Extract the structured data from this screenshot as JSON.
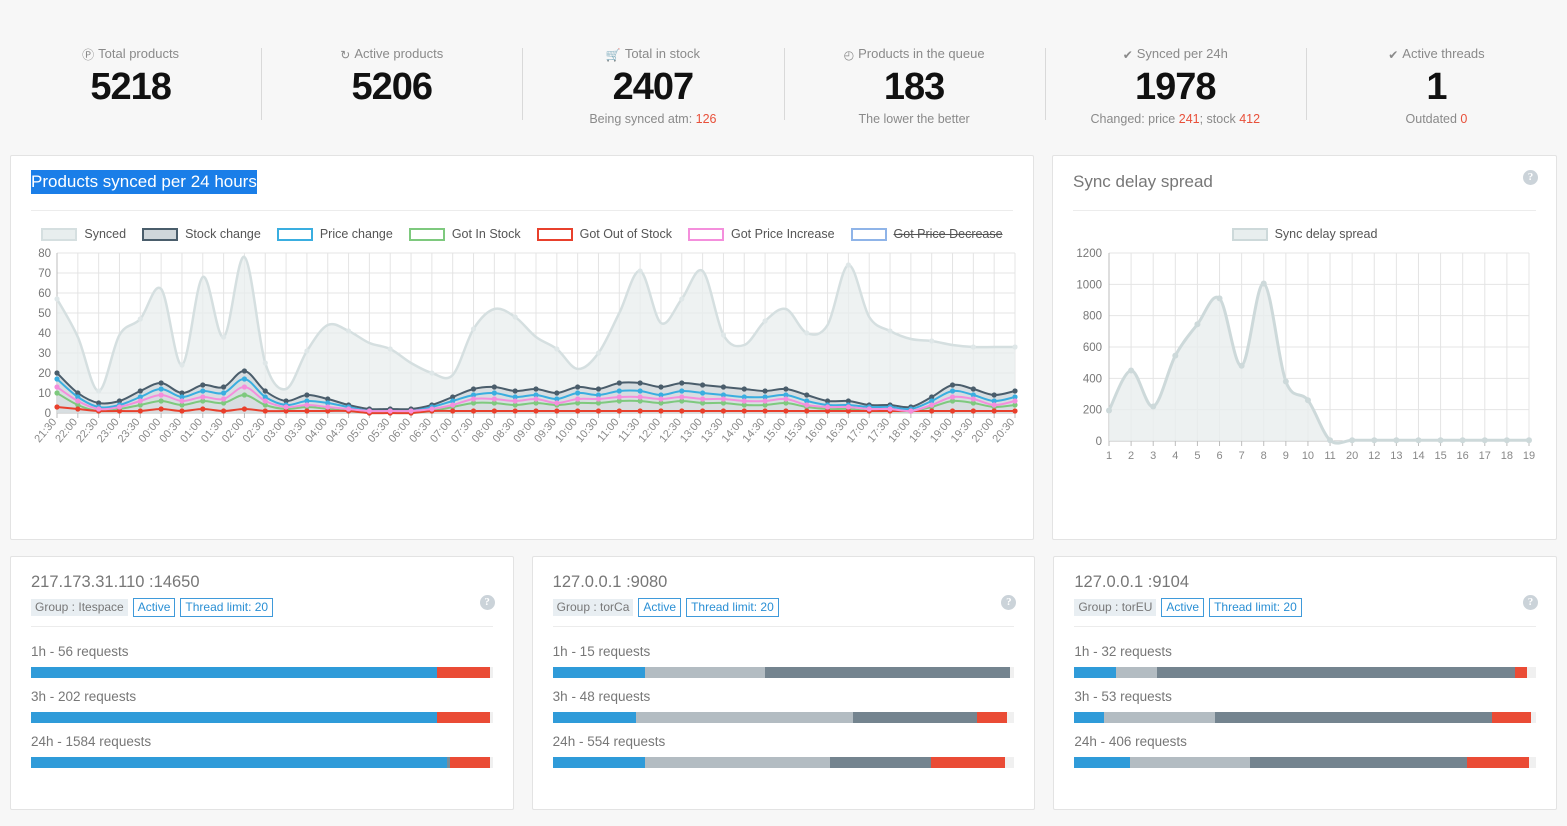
{
  "stats": [
    {
      "icon": "product-icon",
      "icon_glyph": "Ⓟ",
      "label": "Total products",
      "value": "5218",
      "sub": "",
      "sub_accent": ""
    },
    {
      "icon": "refresh-icon",
      "icon_glyph": "↻",
      "label": "Active products",
      "value": "5206",
      "sub": "",
      "sub_accent": ""
    },
    {
      "icon": "cart-icon",
      "icon_glyph": "🛒",
      "label": "Total in stock",
      "value": "2407",
      "sub": "Being synced atm: ",
      "sub_accent": "126"
    },
    {
      "icon": "clock-icon",
      "icon_glyph": "◴",
      "label": "Products in the queue",
      "value": "183",
      "sub": "The lower the better",
      "sub_accent": ""
    },
    {
      "icon": "check-icon",
      "icon_glyph": "✔",
      "label": "Synced per 24h",
      "value": "1978",
      "sub": "Changed: price ",
      "sub_accent": "241",
      "sub2": "; stock ",
      "sub_accent2": "412"
    },
    {
      "icon": "check-icon",
      "icon_glyph": "✔",
      "label": "Active threads",
      "value": "1",
      "sub": "Outdated ",
      "sub_accent": "0"
    }
  ],
  "main_chart_panel": {
    "title": "Products synced per 24 hours",
    "title_selected": true,
    "help_icon": "help-icon"
  },
  "side_chart_panel": {
    "title": "Sync delay spread",
    "help_icon": "help-icon"
  },
  "chart_data": [
    {
      "type": "area",
      "title": "Products synced per 24 hours",
      "xlabel": "",
      "ylabel": "",
      "ylim": [
        0,
        80
      ],
      "yticks": [
        0,
        10,
        20,
        30,
        40,
        50,
        60,
        70,
        80
      ],
      "grid": true,
      "legend_position": "top",
      "categories": [
        "21:30",
        "22:00",
        "22:30",
        "23:00",
        "23:30",
        "00:00",
        "00:30",
        "01:00",
        "01:30",
        "02:00",
        "02:30",
        "03:00",
        "03:30",
        "04:00",
        "04:30",
        "05:00",
        "05:30",
        "06:00",
        "06:30",
        "07:00",
        "07:30",
        "08:00",
        "08:30",
        "09:00",
        "09:30",
        "10:00",
        "10:30",
        "11:00",
        "11:30",
        "12:00",
        "12:30",
        "13:00",
        "13:30",
        "14:00",
        "14:30",
        "15:00",
        "15:30",
        "16:00",
        "16:30",
        "17:00",
        "17:30",
        "18:00",
        "18:30",
        "19:00",
        "19:30",
        "20:00",
        "20:30"
      ],
      "series": [
        {
          "name": "Synced",
          "color": "#e8eeee",
          "line_color": "#d5dfe0",
          "fill": true,
          "values": [
            57,
            38,
            11,
            39,
            47,
            62,
            24,
            68,
            38,
            78,
            25,
            12,
            31,
            44,
            41,
            35,
            32,
            25,
            20,
            19,
            42,
            52,
            48,
            38,
            32,
            22,
            30,
            50,
            71,
            45,
            57,
            71,
            39,
            34,
            46,
            52,
            40,
            44,
            74,
            48,
            41,
            37,
            36,
            34,
            33,
            33,
            33
          ]
        },
        {
          "name": "Stock change",
          "color": "#cfd6da",
          "line_color": "#4a5d6b",
          "fill": true,
          "values": [
            20,
            10,
            5,
            6,
            11,
            15,
            10,
            14,
            13,
            21,
            11,
            6,
            9,
            7,
            4,
            2,
            2,
            2,
            4,
            8,
            12,
            13,
            11,
            12,
            10,
            13,
            12,
            15,
            15,
            13,
            15,
            14,
            13,
            12,
            11,
            12,
            9,
            6,
            6,
            4,
            4,
            3,
            8,
            14,
            12,
            9,
            11
          ]
        },
        {
          "name": "Price change",
          "color": "#ffffff",
          "line_color": "#3aaee0",
          "fill": false,
          "values": [
            17,
            8,
            3,
            4,
            8,
            12,
            8,
            11,
            10,
            17,
            8,
            4,
            6,
            5,
            3,
            1,
            1,
            1,
            3,
            6,
            9,
            10,
            8,
            9,
            7,
            10,
            9,
            11,
            11,
            9,
            11,
            10,
            9,
            8,
            8,
            9,
            6,
            4,
            4,
            3,
            3,
            2,
            6,
            11,
            9,
            6,
            8
          ]
        },
        {
          "name": "Got In Stock",
          "color": "#ffffff",
          "line_color": "#7ec97e",
          "fill": false,
          "values": [
            10,
            4,
            1,
            2,
            4,
            6,
            4,
            6,
            5,
            9,
            4,
            2,
            3,
            2,
            1,
            0,
            0,
            0,
            1,
            3,
            5,
            5,
            4,
            5,
            4,
            5,
            5,
            6,
            6,
            5,
            6,
            5,
            5,
            4,
            4,
            5,
            3,
            2,
            2,
            1,
            1,
            1,
            3,
            6,
            5,
            3,
            4
          ]
        },
        {
          "name": "Got Out of Stock",
          "color": "#ffffff",
          "line_color": "#e8402c",
          "fill": false,
          "values": [
            3,
            2,
            1,
            1,
            1,
            2,
            1,
            2,
            1,
            2,
            1,
            1,
            1,
            1,
            1,
            0,
            0,
            0,
            1,
            1,
            1,
            1,
            1,
            1,
            1,
            1,
            1,
            1,
            1,
            1,
            1,
            1,
            1,
            1,
            1,
            1,
            1,
            1,
            1,
            1,
            1,
            1,
            1,
            1,
            1,
            1,
            1
          ]
        },
        {
          "name": "Got Price Increase",
          "color": "#ffffff",
          "line_color": "#f48fdc",
          "fill": false,
          "values": [
            13,
            6,
            2,
            3,
            6,
            9,
            6,
            8,
            7,
            13,
            6,
            3,
            4,
            3,
            2,
            1,
            1,
            1,
            2,
            4,
            7,
            7,
            6,
            7,
            5,
            7,
            7,
            8,
            8,
            7,
            8,
            7,
            7,
            6,
            6,
            7,
            4,
            3,
            3,
            2,
            2,
            1,
            4,
            8,
            7,
            4,
            6
          ]
        },
        {
          "name": "Got Price Decrease",
          "color": "#ffffff",
          "line_color": "#8fb4e8",
          "fill": false,
          "disabled": true,
          "values": [
            0,
            0,
            0,
            0,
            0,
            0,
            0,
            0,
            0,
            0,
            0,
            0,
            0,
            0,
            0,
            0,
            0,
            0,
            0,
            0,
            0,
            0,
            0,
            0,
            0,
            0,
            0,
            0,
            0,
            0,
            0,
            0,
            0,
            0,
            0,
            0,
            0,
            0,
            0,
            0,
            0,
            0,
            0,
            0,
            0,
            0,
            0
          ]
        }
      ]
    },
    {
      "type": "area",
      "title": "Sync delay spread",
      "xlabel": "",
      "ylabel": "",
      "ylim": [
        0,
        1200
      ],
      "yticks": [
        0,
        200,
        400,
        600,
        800,
        1000,
        1200
      ],
      "grid": true,
      "legend_position": "top",
      "legend": [
        "Sync delay spread"
      ],
      "categories": [
        "1",
        "2",
        "3",
        "4",
        "5",
        "6",
        "7",
        "8",
        "9",
        "10",
        "11",
        "20",
        "12",
        "13",
        "14",
        "15",
        "16",
        "17",
        "18",
        "19"
      ],
      "series": [
        {
          "name": "Sync delay spread",
          "color": "#e8eeee",
          "line_color": "#cdd9da",
          "fill": true,
          "values": [
            195,
            450,
            220,
            545,
            745,
            910,
            480,
            1005,
            380,
            260,
            5,
            5,
            5,
            5,
            5,
            5,
            5,
            5,
            5,
            5
          ]
        }
      ]
    }
  ],
  "cards": [
    {
      "title": "217.173.31.110 :14650",
      "group_tag": "Group : Itespace",
      "status_tag": "Active",
      "thread_tag": "Thread limit: 20",
      "bars": [
        {
          "label": "1h - 56 requests",
          "segments": [
            {
              "color": "#2f9bd9",
              "pct": 88
            },
            {
              "color": "#ea4b35",
              "pct": 11.4
            }
          ]
        },
        {
          "label": "3h - 202 requests",
          "segments": [
            {
              "color": "#2f9bd9",
              "pct": 88
            },
            {
              "color": "#ea4b35",
              "pct": 11.4
            }
          ]
        },
        {
          "label": "24h - 1584 requests",
          "segments": [
            {
              "color": "#2f9bd9",
              "pct": 90
            },
            {
              "color": "#7a8b96",
              "pct": 0.7
            },
            {
              "color": "#ea4b35",
              "pct": 8.8
            }
          ]
        }
      ]
    },
    {
      "title": "127.0.0.1 :9080",
      "group_tag": "Group : torCa",
      "status_tag": "Active",
      "thread_tag": "Thread limit: 20",
      "bars": [
        {
          "label": "1h - 15 requests",
          "segments": [
            {
              "color": "#2f9bd9",
              "pct": 20
            },
            {
              "color": "#b3bcc2",
              "pct": 26
            },
            {
              "color": "#74848f",
              "pct": 53
            }
          ]
        },
        {
          "label": "3h - 48 requests",
          "segments": [
            {
              "color": "#2f9bd9",
              "pct": 18
            },
            {
              "color": "#b3bcc2",
              "pct": 47
            },
            {
              "color": "#74848f",
              "pct": 27
            },
            {
              "color": "#ea4b35",
              "pct": 6.5
            }
          ]
        },
        {
          "label": "24h - 554 requests",
          "segments": [
            {
              "color": "#2f9bd9",
              "pct": 20
            },
            {
              "color": "#b3bcc2",
              "pct": 40
            },
            {
              "color": "#74848f",
              "pct": 22
            },
            {
              "color": "#ea4b35",
              "pct": 16
            }
          ]
        }
      ]
    },
    {
      "title": "127.0.0.1 :9104",
      "group_tag": "Group : torEU",
      "status_tag": "Active",
      "thread_tag": "Thread limit: 20",
      "bars": [
        {
          "label": "1h - 32 requests",
          "segments": [
            {
              "color": "#2f9bd9",
              "pct": 9
            },
            {
              "color": "#b3bcc2",
              "pct": 9
            },
            {
              "color": "#74848f",
              "pct": 77.5
            },
            {
              "color": "#ea4b35",
              "pct": 2.5
            }
          ]
        },
        {
          "label": "3h - 53 requests",
          "segments": [
            {
              "color": "#2f9bd9",
              "pct": 6.5
            },
            {
              "color": "#b3bcc2",
              "pct": 24
            },
            {
              "color": "#74848f",
              "pct": 60
            },
            {
              "color": "#ea4b35",
              "pct": 8.5
            }
          ]
        },
        {
          "label": "24h - 406 requests",
          "segments": [
            {
              "color": "#2f9bd9",
              "pct": 12
            },
            {
              "color": "#b3bcc2",
              "pct": 26
            },
            {
              "color": "#74848f",
              "pct": 47
            },
            {
              "color": "#ea4b35",
              "pct": 13.5
            }
          ]
        }
      ]
    }
  ],
  "colors": {
    "accent_blue": "#2f9bd9",
    "accent_red": "#ea4b35",
    "selection_blue": "#1a7ee8",
    "panel_bg": "#ffffff",
    "page_bg": "#f7f7f7"
  }
}
